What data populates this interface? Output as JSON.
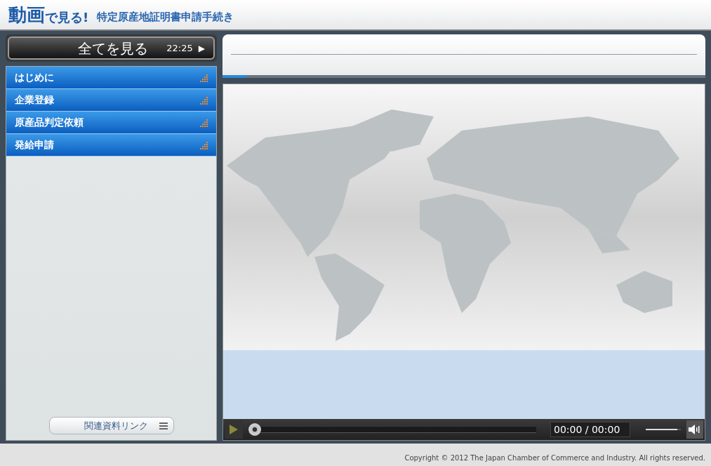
{
  "header": {
    "logo": "動画",
    "logo_sub": "で見る!",
    "title": "特定原産地証明書申請手続き"
  },
  "sidebar": {
    "play_all": {
      "label": "全てを見る",
      "duration": "22:25",
      "icon": "▶"
    },
    "chapters": [
      {
        "label": "はじめに",
        "selected": false
      },
      {
        "label": "企業登録",
        "selected": false
      },
      {
        "label": "原産品判定依頼",
        "selected": false
      },
      {
        "label": "発給申請",
        "selected": false
      }
    ],
    "links_button": "関連資料リンク"
  },
  "info_panel": {
    "level": 0.05
  },
  "player": {
    "seek": {
      "level": 0
    },
    "time": "00:00 / 00:00",
    "volume": {
      "level": 0.9
    }
  },
  "footer": "Copyright © 2012 The Japan Chamber of Commerce and Industry. All rights reserved."
}
